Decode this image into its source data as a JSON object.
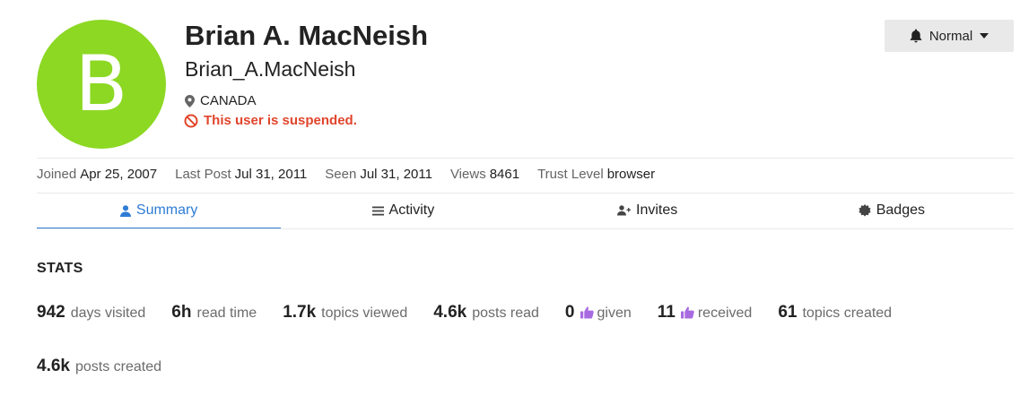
{
  "colors": {
    "avatar_bg": "#8cd823",
    "accent": "#2f7cd6",
    "suspended": "#e0452b",
    "like": "#a86ae0"
  },
  "user": {
    "avatar_letter": "B",
    "full_name": "Brian A. MacNeish",
    "username": "Brian_A.MacNeish",
    "location": "CANADA",
    "suspended_text": "This user is suspended."
  },
  "notifications": {
    "label": "Normal",
    "icon": "bell-icon"
  },
  "meta": [
    {
      "label": "Joined",
      "value": "Apr 25, 2007"
    },
    {
      "label": "Last Post",
      "value": "Jul 31, 2011"
    },
    {
      "label": "Seen",
      "value": "Jul 31, 2011"
    },
    {
      "label": "Views",
      "value": "8461"
    },
    {
      "label": "Trust Level",
      "value": "browser"
    }
  ],
  "tabs": [
    {
      "label": "Summary",
      "icon": "user-icon",
      "active": true
    },
    {
      "label": "Activity",
      "icon": "list-icon",
      "active": false
    },
    {
      "label": "Invites",
      "icon": "user-plus-icon",
      "active": false
    },
    {
      "label": "Badges",
      "icon": "badge-icon",
      "active": false
    }
  ],
  "stats": {
    "title": "STATS",
    "items": [
      {
        "number": "942",
        "label": "days visited"
      },
      {
        "number": "6h",
        "label": "read time"
      },
      {
        "number": "1.7k",
        "label": "topics viewed"
      },
      {
        "number": "4.6k",
        "label": "posts read"
      },
      {
        "number": "0",
        "label": "given",
        "icon": "heart-like-icon"
      },
      {
        "number": "11",
        "label": "received",
        "icon": "heart-like-icon"
      },
      {
        "number": "61",
        "label": "topics created"
      },
      {
        "number": "4.6k",
        "label": "posts created"
      }
    ]
  }
}
